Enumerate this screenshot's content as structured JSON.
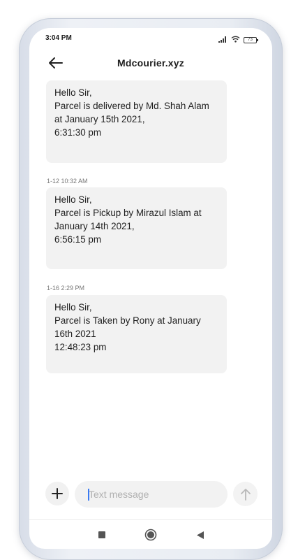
{
  "status_bar": {
    "time": "3:04 PM",
    "battery": "73",
    "icons": [
      "signal-icon",
      "wifi-icon",
      "battery-icon"
    ]
  },
  "header": {
    "title": "Mdcourier.xyz",
    "back_icon": "arrow-left-icon"
  },
  "messages": [
    {
      "timestamp": "",
      "lines": [
        "Hello Sir,",
        "Parcel is delivered by Md. Shah Alam",
        "at January 15th 2021,",
        "6:31:30 pm"
      ]
    },
    {
      "timestamp": "1-12 10:32 AM",
      "lines": [
        "Hello Sir,",
        "Parcel is Pickup by Mirazul Islam at",
        "January 14th 2021,",
        "6:56:15 pm"
      ]
    },
    {
      "timestamp": "1-16 2:29 PM",
      "lines": [
        "Hello Sir,",
        "Parcel is Taken by Rony at January",
        "16th 2021",
        "12:48:23 pm"
      ]
    }
  ],
  "compose": {
    "placeholder": "Text message",
    "value": "",
    "add_icon": "plus-icon",
    "send_icon": "arrow-up-icon"
  },
  "nav": {
    "icons": [
      "square-recents-icon",
      "circle-home-icon",
      "triangle-back-icon"
    ]
  },
  "colors": {
    "bubble": "#f2f2f2",
    "caret": "#3b7bf2",
    "frame": "#e9edf3"
  }
}
